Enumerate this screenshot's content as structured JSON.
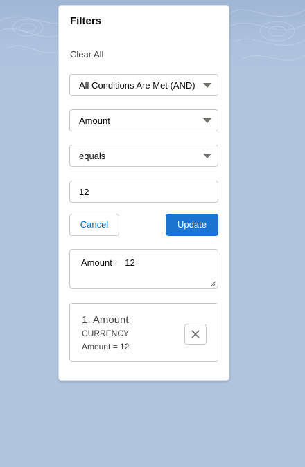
{
  "panel": {
    "title": "Filters",
    "clear_all_label": "Clear All"
  },
  "logic_select": {
    "value": "All Conditions Are Met (AND)"
  },
  "field_select": {
    "value": "Amount"
  },
  "operator_select": {
    "value": "equals"
  },
  "value_input": {
    "value": "12"
  },
  "buttons": {
    "cancel_label": "Cancel",
    "update_label": "Update"
  },
  "expression_box": {
    "value": "Amount =  12"
  },
  "filter_card": {
    "title": "1. Amount",
    "type": "CURRENCY",
    "expression": "Amount = 12",
    "remove_icon": "close-icon"
  },
  "colors": {
    "background": "#b0c4de",
    "brand": "#1b73d2",
    "link": "#0070d2"
  }
}
